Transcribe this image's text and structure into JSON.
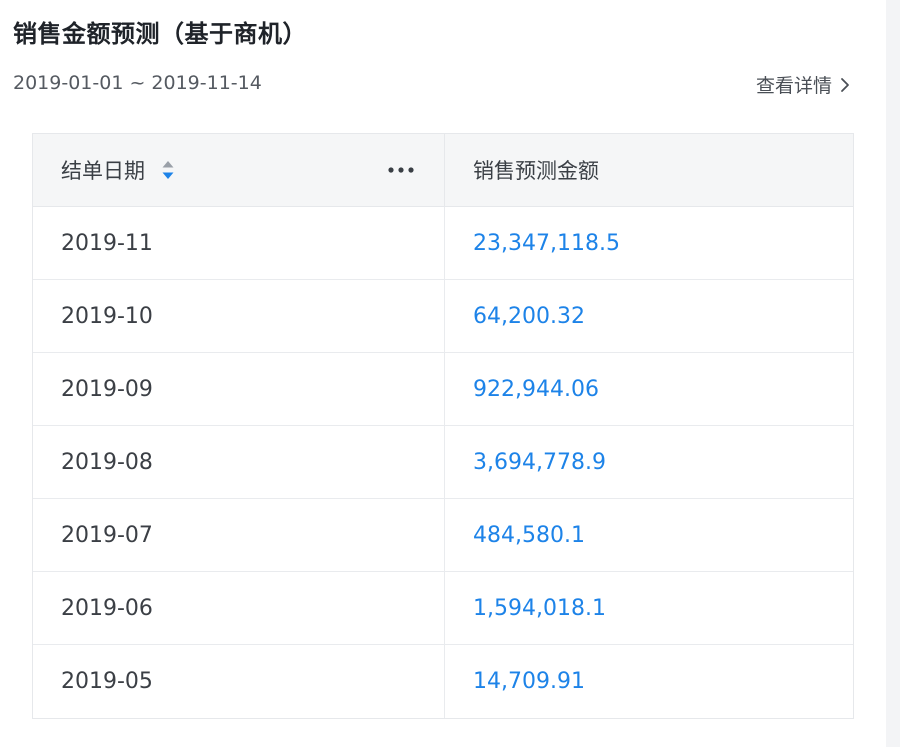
{
  "header": {
    "title": "销售金额预测（基于商机）",
    "date_range": "2019-01-01 ~ 2019-11-14",
    "details_link": "查看详情"
  },
  "table": {
    "columns": [
      "结单日期",
      "销售预测金额"
    ],
    "rows": [
      {
        "date": "2019-11",
        "amount": "23,347,118.5"
      },
      {
        "date": "2019-10",
        "amount": "64,200.32"
      },
      {
        "date": "2019-09",
        "amount": "922,944.06"
      },
      {
        "date": "2019-08",
        "amount": "3,694,778.9"
      },
      {
        "date": "2019-07",
        "amount": "484,580.1"
      },
      {
        "date": "2019-06",
        "amount": "1,594,018.1"
      },
      {
        "date": "2019-05",
        "amount": "14,709.91"
      }
    ]
  },
  "icons": {
    "sort": "sort-icon",
    "more": "more-icon",
    "chevron": "chevron-right-icon"
  },
  "colors": {
    "amount_link": "#1d83e8",
    "sort_active": "#1d83e8",
    "header_bg": "#f5f6f7"
  }
}
